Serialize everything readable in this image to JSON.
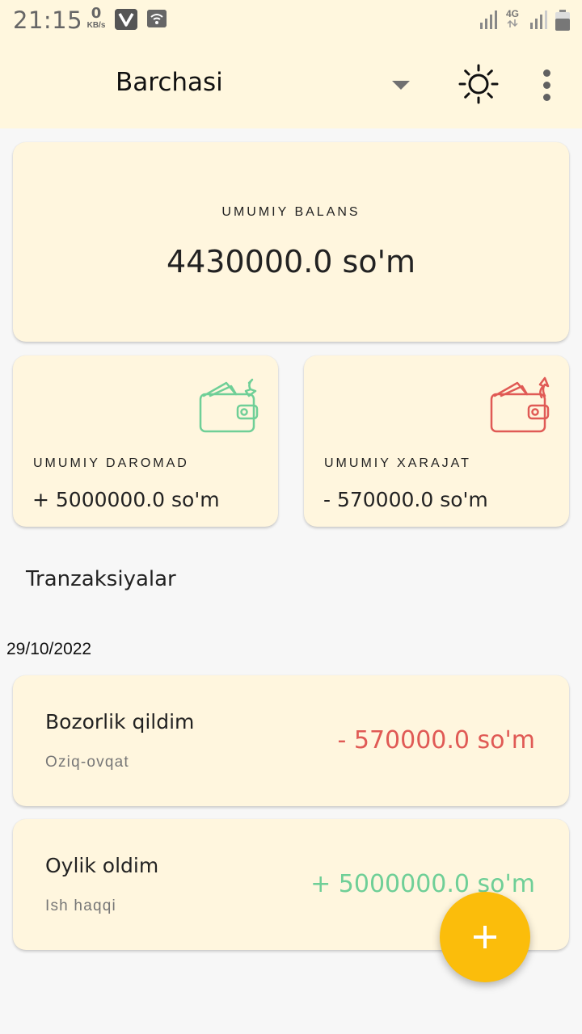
{
  "status_bar": {
    "time": "21:15",
    "net_speed_value": "0",
    "net_speed_unit": "KB/s",
    "network_type": "4G",
    "icons": [
      "vpn-v-icon",
      "wifi-icon",
      "signal-icon",
      "signal-icon",
      "battery-icon"
    ]
  },
  "app_bar": {
    "filter_label": "Barchasi",
    "icons": [
      "dropdown-arrow-icon",
      "sun-icon",
      "more-vert-icon"
    ]
  },
  "balance": {
    "label": "UMUMIY BALANS",
    "value": "4430000.0 so'm"
  },
  "income": {
    "label": "UMUMIY DAROMAD",
    "value": "+ 5000000.0 so'm",
    "icon": "wallet-in-icon",
    "color": "#6fcf97"
  },
  "expense": {
    "label": "UMUMIY XARAJAT",
    "value": "- 570000.0 so'm",
    "icon": "wallet-out-icon",
    "color": "#e05a55"
  },
  "transactions": {
    "title": "Tranzaksiyalar",
    "groups": [
      {
        "date": "29/10/2022",
        "items": [
          {
            "title": "Bozorlik qildim",
            "category": "Oziq-ovqat",
            "amount": "- 570000.0 so'm",
            "type": "expense"
          },
          {
            "title": "Oylik oldim",
            "category": "Ish haqqi",
            "amount": "+ 5000000.0 so'm",
            "type": "income"
          }
        ]
      }
    ]
  },
  "fab": {
    "icon": "plus-icon",
    "color": "#fbbd0b"
  },
  "colors": {
    "app_bar_bg": "#fff7de",
    "card_bg": "#fff6de",
    "page_bg": "#f7f7f7",
    "income": "#6fcf97",
    "expense": "#e05a55",
    "accent": "#fbbd0b"
  }
}
